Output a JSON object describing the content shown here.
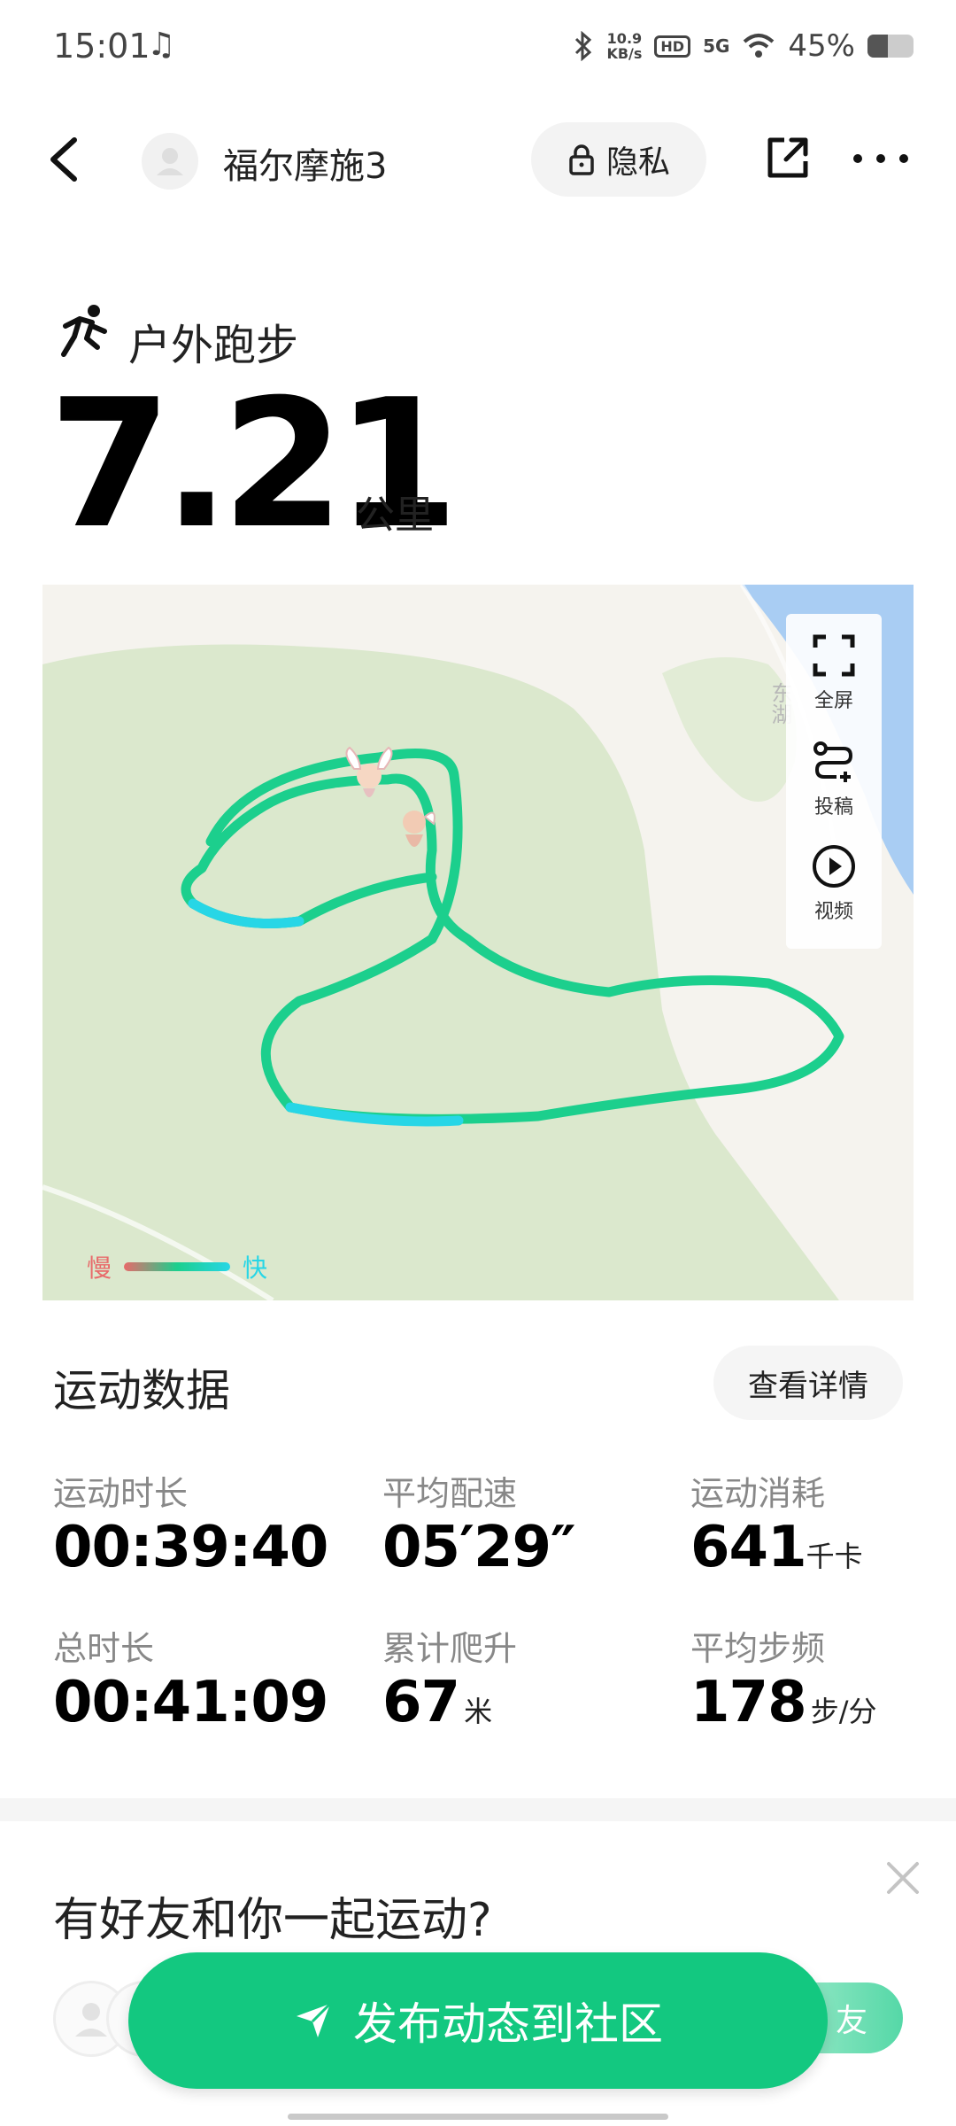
{
  "status_bar": {
    "time": "15:01",
    "music_icon": "♫",
    "bluetooth_icon": "bluetooth",
    "net_speed_value": "10.9",
    "net_speed_unit": "KB/s",
    "hd_badge": "HD",
    "network_type": "5G",
    "battery_text": "45%",
    "battery_level": 0.45
  },
  "nav": {
    "title": "福尔摩施3",
    "privacy_label": "隐私"
  },
  "activity": {
    "type": "户外跑步",
    "distance": "7.21",
    "unit": "公里"
  },
  "map": {
    "place_label": "东湖",
    "tools": [
      {
        "icon": "fullscreen-icon",
        "label": "全屏"
      },
      {
        "icon": "post-icon",
        "label": "投稿"
      },
      {
        "icon": "video-icon",
        "label": "视频"
      }
    ],
    "legend": {
      "slow": "慢",
      "fast": "快"
    },
    "colors": {
      "route": "#1ccf8d",
      "route_fast": "#27d6e6",
      "park": "#dbe8cd",
      "water": "#a9cdf3",
      "land": "#f5f3ee"
    }
  },
  "stats": {
    "title": "运动数据",
    "details_button": "查看详情",
    "items": [
      {
        "label": "运动时长",
        "value": "00:39:40",
        "unit": ""
      },
      {
        "label": "平均配速",
        "value": "05′29″",
        "unit": ""
      },
      {
        "label": "运动消耗",
        "value": "641",
        "unit": "千卡"
      },
      {
        "label": "总时长",
        "value": "00:41:09",
        "unit": ""
      },
      {
        "label": "累计爬升",
        "value": "67",
        "unit": "米"
      },
      {
        "label": "平均步频",
        "value": "178",
        "unit": "步/分"
      }
    ]
  },
  "friends": {
    "title": "有好友和你一起运动?",
    "invite_button_partial": "友"
  },
  "publish_button": "发布动态到社区",
  "accent_color": "#13c880"
}
